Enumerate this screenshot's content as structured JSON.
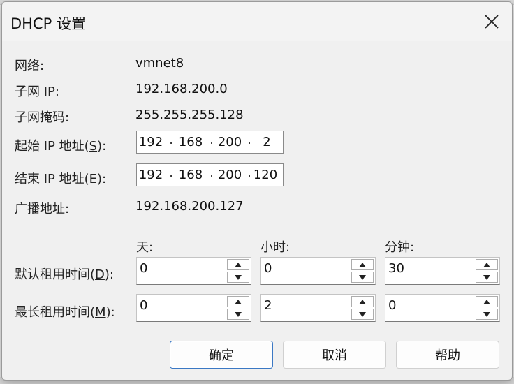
{
  "dialog": {
    "title": "DHCP 设置"
  },
  "fields": {
    "network_label": "网络:",
    "network_value": "vmnet8",
    "subnet_label": "子网 IP:",
    "subnet_value": "192.168.200.0",
    "mask_label": "子网掩码:",
    "mask_value": "255.255.255.128",
    "start_label_pre": "起始 IP 地址(",
    "start_label_key": "S",
    "start_label_post": "):",
    "start_ip": [
      "192",
      "168",
      "200",
      "2"
    ],
    "end_label_pre": "结束 IP 地址(",
    "end_label_key": "E",
    "end_label_post": "):",
    "end_ip": [
      "192",
      "168",
      "200",
      "120"
    ],
    "broadcast_label": "广播地址:",
    "broadcast_value": "192.168.200.127",
    "ip_separator": "."
  },
  "lease": {
    "col_days": "天:",
    "col_hours": "小时:",
    "col_minutes": "分钟:",
    "default_label_pre": "默认租用时间(",
    "default_label_key": "D",
    "default_label_post": "):",
    "default_days": "0",
    "default_hours": "0",
    "default_minutes": "30",
    "max_label_pre": "最长租用时间(",
    "max_label_key": "M",
    "max_label_post": "):",
    "max_days": "0",
    "max_hours": "2",
    "max_minutes": "0"
  },
  "buttons": {
    "ok": "确定",
    "cancel": "取消",
    "help": "帮助"
  },
  "icons": {
    "close": "close-icon",
    "spin_up": "chevron-up-icon",
    "spin_down": "chevron-down-icon"
  },
  "colors": {
    "dialog_bg": "#f0f0f0",
    "accent_border": "#3b78c4"
  }
}
